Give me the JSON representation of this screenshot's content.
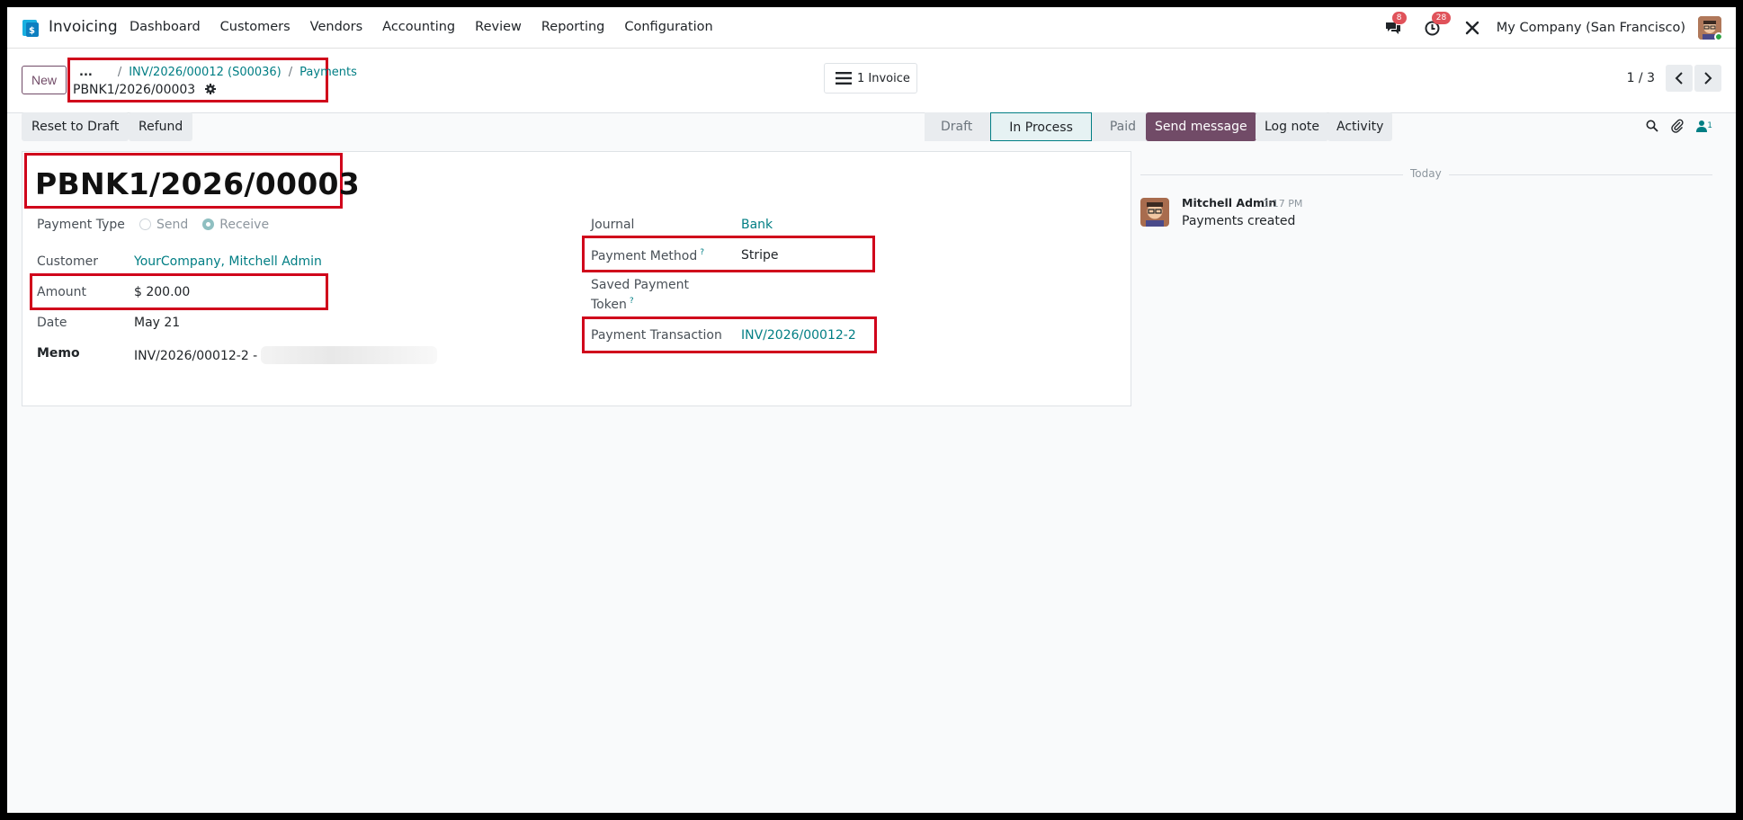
{
  "nav": {
    "app_name": "Invoicing",
    "menu": [
      "Dashboard",
      "Customers",
      "Vendors",
      "Accounting",
      "Review",
      "Reporting",
      "Configuration"
    ],
    "messages_badge": "8",
    "activities_badge": "28",
    "company": "My Company (San Francisco)"
  },
  "control": {
    "new_label": "New",
    "breadcrumb_dots": "...",
    "breadcrumb": [
      "INV/2026/00012 (S00036)",
      "Payments"
    ],
    "current_record": "PBNK1/2026/00003",
    "invoice_button": "1 Invoice",
    "pager": "1 / 3"
  },
  "actions": {
    "reset": "Reset to Draft",
    "refund": "Refund"
  },
  "status": {
    "stages": [
      "Draft",
      "In Process",
      "Paid"
    ],
    "active": "In Process"
  },
  "form": {
    "title": "PBNK1/2026/00003",
    "payment_type_label": "Payment Type",
    "payment_type_options": [
      "Send",
      "Receive"
    ],
    "payment_type_selected": "Receive",
    "customer_label": "Customer",
    "customer_value": "YourCompany, Mitchell Admin",
    "amount_label": "Amount",
    "amount_value": "$ 200.00",
    "date_label": "Date",
    "date_value": "May 21",
    "memo_label": "Memo",
    "memo_value": "INV/2026/00012-2 -",
    "journal_label": "Journal",
    "journal_value": "Bank",
    "method_label": "Payment Method",
    "method_value": "Stripe",
    "token_label_1": "Saved Payment",
    "token_label_2": "Token",
    "help_mark": "?",
    "transaction_label": "Payment Transaction",
    "transaction_value": "INV/2026/00012-2"
  },
  "chatter": {
    "send_message": "Send message",
    "log_note": "Log note",
    "activity": "Activity",
    "followers_count": "1",
    "date_separator": "Today",
    "message": {
      "author": "Mitchell Admin",
      "time": "1:17 PM",
      "body": "Payments created"
    }
  },
  "colors": {
    "brand": "#714b67",
    "link": "#017e84",
    "highlight": "#d0021b"
  }
}
